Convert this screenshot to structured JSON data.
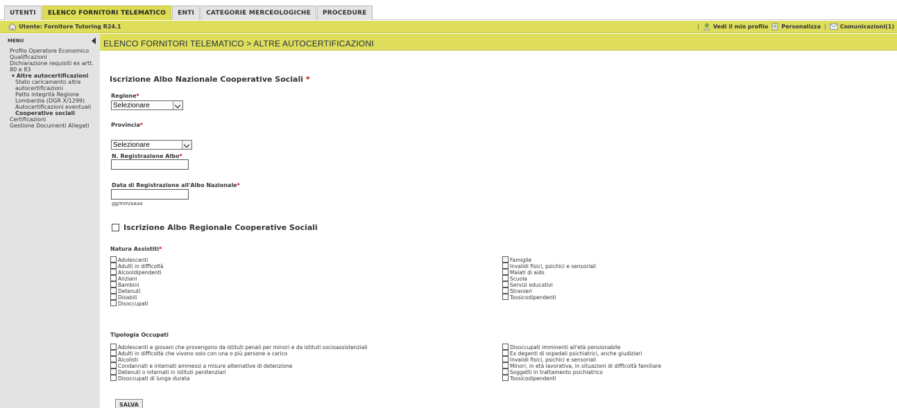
{
  "tabs": [
    {
      "label": "UTENTI"
    },
    {
      "label": "ELENCO FORNITORI TELEMATICO"
    },
    {
      "label": "ENTI"
    },
    {
      "label": "CATEGORIE MERCEOLOGICHE"
    },
    {
      "label": "PROCEDURE"
    }
  ],
  "active_tab": "ELENCO FORNITORI TELEMATICO",
  "userbar": {
    "user": "Utente: Fornitore Tutoring R24.1",
    "profile_link": "Vedi il mio profilo",
    "personalize_link": "Personalizza",
    "communications_link": "Comunicazioni(1)",
    "separator": "|"
  },
  "sidebar": {
    "menu_label": "MENU",
    "items": [
      "Profilo Operatore Economico",
      "Qualificazioni",
      "Dichiarazione requisiti ex artt. 80 e 83"
    ],
    "section": "▾ Altre autocertificazioni",
    "sub_items": [
      "Stato caricamento altre autocertificazioni",
      "Patto integrità Regione Lombardia (DGR X/1299)",
      "Autocertificazioni eventuali",
      "Cooperative sociali"
    ],
    "bottom_items": [
      "Certificazioni",
      "Gestione Documenti Allegati"
    ]
  },
  "page_title": "ELENCO FORNITORI TELEMATICO  > ALTRE AUTOCERTIFICAZIONI",
  "form": {
    "heading": "Iscrizione Albo Nazionale Cooperative Sociali",
    "required_mark": "*",
    "regione_label": "Regione",
    "regione_value": "Selezionare",
    "provincia_label": "Provincia",
    "provincia_value": "Selezionare",
    "n_registrazione_label": "N. Registrazione Albo",
    "n_registrazione_value": "",
    "data_registrazione_label": "Data di Registrazione all'Albo Nazionale",
    "data_registrazione_value": "",
    "date_hint": "gg/mm/aaaa",
    "albo_regionale_label": "Iscrizione Albo Regionale Cooperative Sociali",
    "natura_label": "Natura Assistiti",
    "natura_col1": [
      "Adolescenti",
      "Adulti in difficoltà",
      "Alcooldipendenti",
      "Anziani",
      "Bambini",
      "Detenuti",
      "Disabili",
      "Disoccupati"
    ],
    "natura_col2": [
      "Famiglie",
      "Invalidi fisici, psichici e sensoriali",
      "Malati di aids",
      "Scuola",
      "Servizi educativi",
      "Stranieri",
      "Tossicodipendenti"
    ],
    "tipologia_label": "Tipologia Occupati",
    "tipologia_col1": [
      "Adolescenti e giovani che provengono da istituti penali per minori e da istituti socioassistenziali",
      "Adulti in difficoltà che vivono solo con una o più persone a carico",
      "Alcolisti",
      "Condannati e internati ammessi a misure alternative di detenzione",
      "Detenuti o internati in istituti penitenziari",
      "Disoccupati di lunga durata"
    ],
    "tipologia_col2": [
      "Disoccupati imminenti all'età pensionabile",
      "Ex degenti di ospedali psichiatrici, anche giudiziari",
      "Invalidi fisici, psichici e sensoriali",
      "Minori, in età lavorativa, in situazioni di difficoltà familiare",
      "Soggetti in trattamento psichiatrico",
      "Tossicodipendenti"
    ],
    "save_label": "SALVA"
  }
}
